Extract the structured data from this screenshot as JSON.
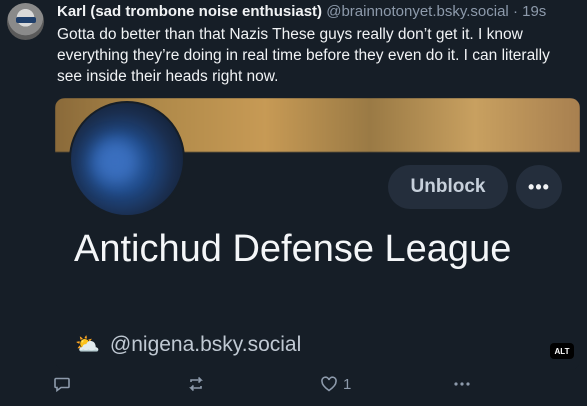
{
  "post": {
    "display_name": "Karl (sad trombone noise enthusiast)",
    "handle": "@brainnotonyet.bsky.social",
    "separator": "·",
    "time": "19s",
    "text": "Gotta do better than that Nazis These guys really don’t get it. I know everything they’re doing in real time before they even do it.  I can literally see inside their heads right now."
  },
  "embed": {
    "unblock_label": "Unblock",
    "more_label": "•••",
    "profile_name": "Antichud Defense League",
    "profile_emoji": "⛅",
    "profile_handle": "@nigena.bsky.social",
    "alt_label": "ALT"
  },
  "actions": {
    "like_count": "1"
  },
  "icons": [
    "reply-icon",
    "repost-icon",
    "like-icon",
    "more-options-icon",
    "sun-icon"
  ]
}
